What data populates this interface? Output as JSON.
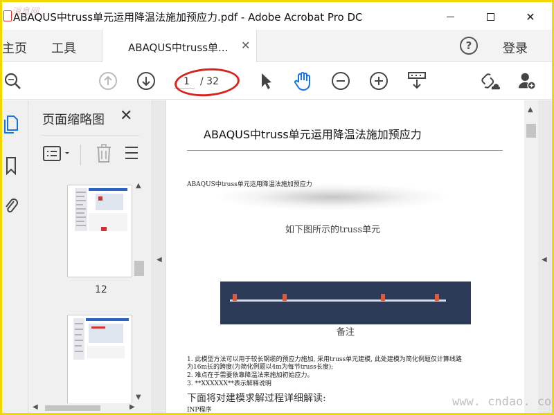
{
  "window": {
    "title": "ABAQUS中truss单元运用降温法施加预应力.pdf - Adobe Acrobat Pro DC",
    "min_icon": "minimize-icon",
    "max_icon": "maximize-icon",
    "close_glyph": "✕"
  },
  "tabs": {
    "home": "主页",
    "tools": "工具",
    "doc_tab_label": "ABAQUS中truss单...",
    "doc_tab_close": "✕",
    "help_glyph": "?",
    "login": "登录"
  },
  "toolbar": {
    "current_page": "1",
    "total_pages": "/ 32",
    "icons": [
      "search-icon",
      "prev-page-icon",
      "next-page-icon",
      "select-arrow-icon",
      "hand-tool-icon",
      "zoom-out-icon",
      "zoom-in-icon",
      "page-fit-icon",
      "share-link-icon",
      "add-user-icon"
    ],
    "annotation_color": "#d9231d"
  },
  "thumbnails_panel": {
    "title": "页面缩略图",
    "close_glyph": "✕",
    "page_label": "12"
  },
  "document": {
    "heading": "ABAQUS中truss单元运用降温法施加预应力",
    "small_title": "ABAQUS中truss单元运用降温法施加预应力",
    "caption_top": "如下图所示的truss单元",
    "caption_bottom": "备注",
    "para1": "1. 此模型方法可以用于较长钢缆的预应力施加, 采用truss单元建模, 此处建模为简化例题仅计算线路",
    "para2": "为16m长的跨度(为简化例题以4m为每节truss长度);",
    "para3": "2. 难点在于需要依靠降温法来施加初始应力。",
    "para4": "3. **XXXXXX**表示解释说明",
    "big_line": "下面将对建模求解过程详细解读:",
    "line_inp": "INP程序"
  },
  "watermarks": {
    "top_left": "消息网",
    "bottom_right": "www. cndao. com"
  }
}
